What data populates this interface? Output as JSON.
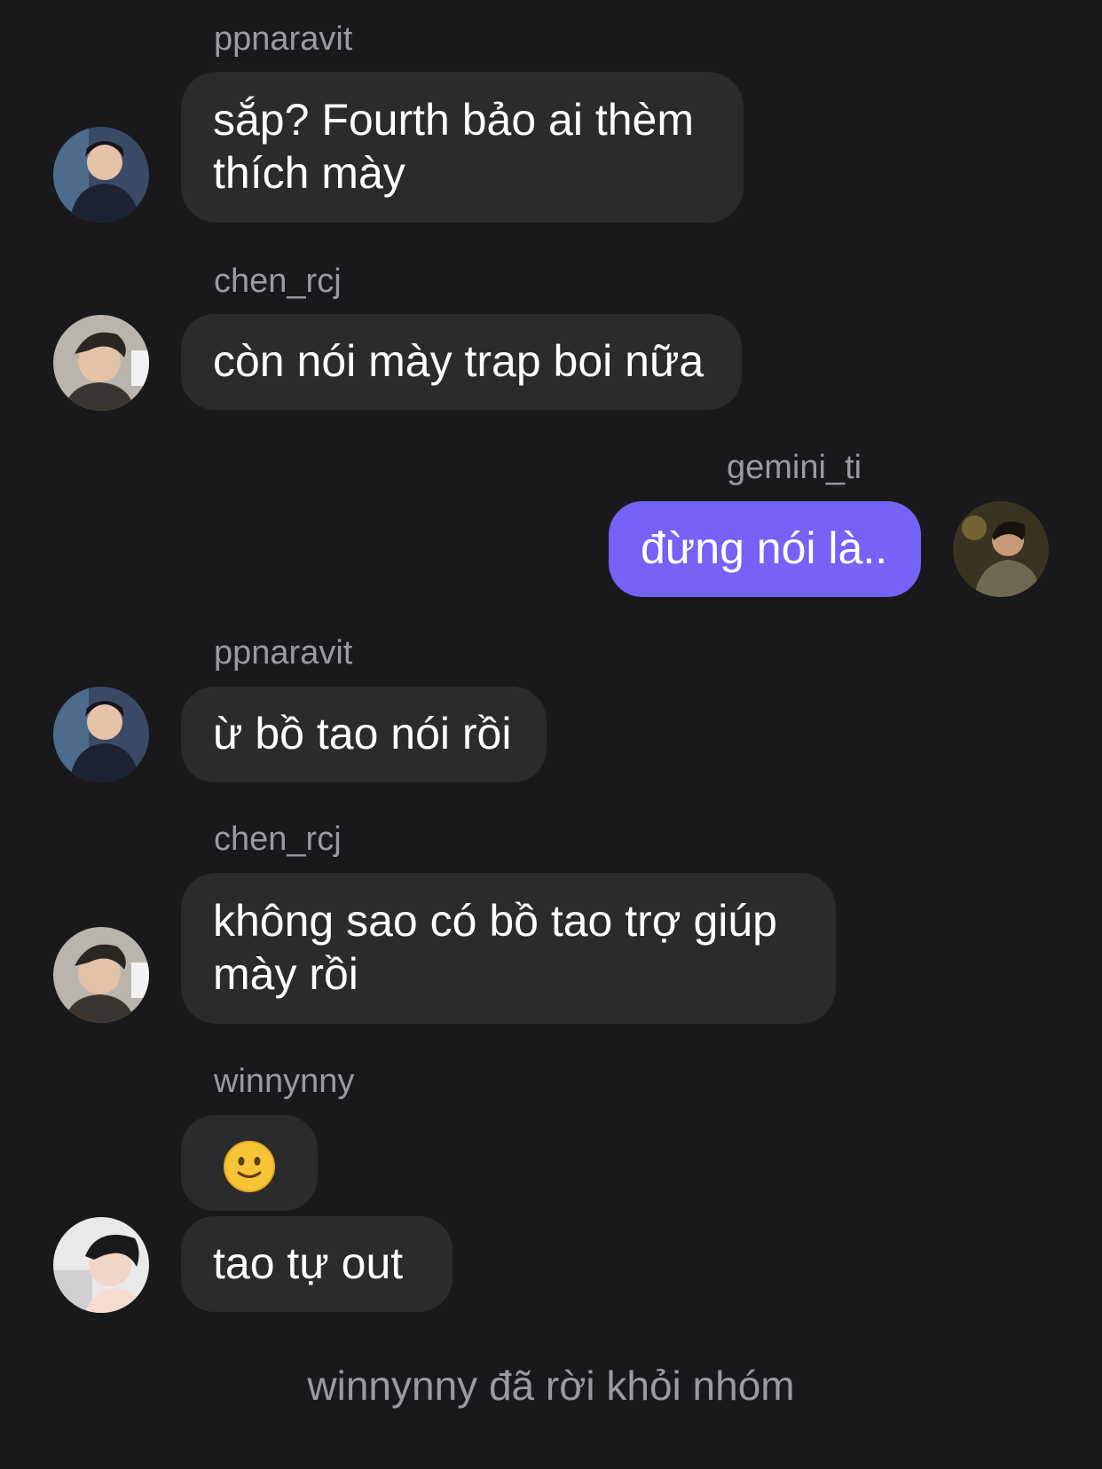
{
  "messages": [
    {
      "sender": "ppnaravit",
      "text": "sắp? Fourth bảo ai thèm thích mày",
      "avatar_icon": "user-avatar-ppnaravit"
    },
    {
      "sender": "chen_rcj",
      "text": "còn nói mày trap boi nữa",
      "avatar_icon": "user-avatar-chen-rcj"
    },
    {
      "sender": "gemini_ti",
      "text": "đừng nói là..",
      "avatar_icon": "user-avatar-gemini-ti",
      "outgoing": true
    },
    {
      "sender": "ppnaravit",
      "text": "ừ bồ tao nói rồi",
      "avatar_icon": "user-avatar-ppnaravit"
    },
    {
      "sender": "chen_rcj",
      "text": "không sao có bồ tao trợ giúp mày rồi",
      "avatar_icon": "user-avatar-chen-rcj"
    },
    {
      "sender": "winnynny",
      "text": "🙂",
      "avatar_icon": "user-avatar-winnynny"
    },
    {
      "sender": "winnynny",
      "text": "tao tự out",
      "avatar_icon": "user-avatar-winnynny"
    }
  ],
  "system_message": "winnynny đã rời khỏi nhóm",
  "colors": {
    "background": "#19191b",
    "incoming_bubble": "#2b2b2e",
    "outgoing_bubble": "#7562f7",
    "sender_text": "#9a9aa0",
    "message_text": "#ffffff"
  }
}
